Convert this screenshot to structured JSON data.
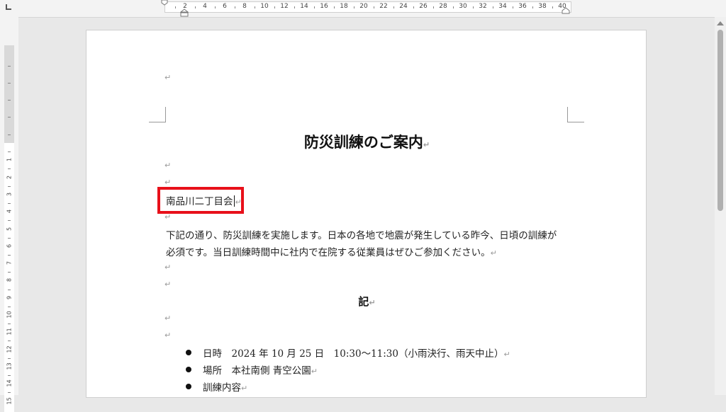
{
  "ruler": {
    "top_numbers": [
      "2",
      "4",
      "6",
      "8",
      "10",
      "12",
      "14",
      "16",
      "18",
      "20",
      "22",
      "24",
      "26",
      "28",
      "30",
      "32",
      "34",
      "36",
      "38",
      "40"
    ],
    "left_numbers": [
      "1",
      "2",
      "3",
      "4",
      "5",
      "6",
      "7",
      "8",
      "9",
      "10",
      "11",
      "12",
      "13",
      "14",
      "15"
    ]
  },
  "document": {
    "return_mark": "↵",
    "title": "防災訓練のご案内",
    "recipient": "南品川二丁目会",
    "body_line1": "下記の通り、防災訓練を実施します。日本の各地で地震が発生している昨今、日頃の訓練が",
    "body_line2": "必須です。当日訓練時間中に社内で在院する従業員はぜひご参加ください。",
    "ki": "記",
    "items": [
      "日時　2024 年 10 月 25 日　10:30～11:30（小雨決行、雨天中止）",
      "場所　本社南側  青空公園",
      "訓練内容"
    ]
  },
  "colors": {
    "highlight": "#e8101a",
    "page": "#ffffff",
    "background": "#e8e8e8"
  }
}
